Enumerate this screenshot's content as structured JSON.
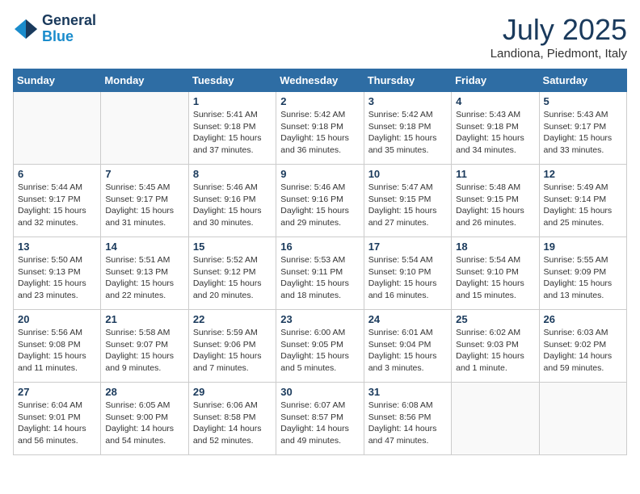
{
  "logo": {
    "line1": "General",
    "line2": "Blue"
  },
  "title": "July 2025",
  "location": "Landiona, Piedmont, Italy",
  "weekdays": [
    "Sunday",
    "Monday",
    "Tuesday",
    "Wednesday",
    "Thursday",
    "Friday",
    "Saturday"
  ],
  "weeks": [
    [
      {
        "day": null
      },
      {
        "day": null
      },
      {
        "day": "1",
        "sunrise": "Sunrise: 5:41 AM",
        "sunset": "Sunset: 9:18 PM",
        "daylight": "Daylight: 15 hours and 37 minutes."
      },
      {
        "day": "2",
        "sunrise": "Sunrise: 5:42 AM",
        "sunset": "Sunset: 9:18 PM",
        "daylight": "Daylight: 15 hours and 36 minutes."
      },
      {
        "day": "3",
        "sunrise": "Sunrise: 5:42 AM",
        "sunset": "Sunset: 9:18 PM",
        "daylight": "Daylight: 15 hours and 35 minutes."
      },
      {
        "day": "4",
        "sunrise": "Sunrise: 5:43 AM",
        "sunset": "Sunset: 9:18 PM",
        "daylight": "Daylight: 15 hours and 34 minutes."
      },
      {
        "day": "5",
        "sunrise": "Sunrise: 5:43 AM",
        "sunset": "Sunset: 9:17 PM",
        "daylight": "Daylight: 15 hours and 33 minutes."
      }
    ],
    [
      {
        "day": "6",
        "sunrise": "Sunrise: 5:44 AM",
        "sunset": "Sunset: 9:17 PM",
        "daylight": "Daylight: 15 hours and 32 minutes."
      },
      {
        "day": "7",
        "sunrise": "Sunrise: 5:45 AM",
        "sunset": "Sunset: 9:17 PM",
        "daylight": "Daylight: 15 hours and 31 minutes."
      },
      {
        "day": "8",
        "sunrise": "Sunrise: 5:46 AM",
        "sunset": "Sunset: 9:16 PM",
        "daylight": "Daylight: 15 hours and 30 minutes."
      },
      {
        "day": "9",
        "sunrise": "Sunrise: 5:46 AM",
        "sunset": "Sunset: 9:16 PM",
        "daylight": "Daylight: 15 hours and 29 minutes."
      },
      {
        "day": "10",
        "sunrise": "Sunrise: 5:47 AM",
        "sunset": "Sunset: 9:15 PM",
        "daylight": "Daylight: 15 hours and 27 minutes."
      },
      {
        "day": "11",
        "sunrise": "Sunrise: 5:48 AM",
        "sunset": "Sunset: 9:15 PM",
        "daylight": "Daylight: 15 hours and 26 minutes."
      },
      {
        "day": "12",
        "sunrise": "Sunrise: 5:49 AM",
        "sunset": "Sunset: 9:14 PM",
        "daylight": "Daylight: 15 hours and 25 minutes."
      }
    ],
    [
      {
        "day": "13",
        "sunrise": "Sunrise: 5:50 AM",
        "sunset": "Sunset: 9:13 PM",
        "daylight": "Daylight: 15 hours and 23 minutes."
      },
      {
        "day": "14",
        "sunrise": "Sunrise: 5:51 AM",
        "sunset": "Sunset: 9:13 PM",
        "daylight": "Daylight: 15 hours and 22 minutes."
      },
      {
        "day": "15",
        "sunrise": "Sunrise: 5:52 AM",
        "sunset": "Sunset: 9:12 PM",
        "daylight": "Daylight: 15 hours and 20 minutes."
      },
      {
        "day": "16",
        "sunrise": "Sunrise: 5:53 AM",
        "sunset": "Sunset: 9:11 PM",
        "daylight": "Daylight: 15 hours and 18 minutes."
      },
      {
        "day": "17",
        "sunrise": "Sunrise: 5:54 AM",
        "sunset": "Sunset: 9:10 PM",
        "daylight": "Daylight: 15 hours and 16 minutes."
      },
      {
        "day": "18",
        "sunrise": "Sunrise: 5:54 AM",
        "sunset": "Sunset: 9:10 PM",
        "daylight": "Daylight: 15 hours and 15 minutes."
      },
      {
        "day": "19",
        "sunrise": "Sunrise: 5:55 AM",
        "sunset": "Sunset: 9:09 PM",
        "daylight": "Daylight: 15 hours and 13 minutes."
      }
    ],
    [
      {
        "day": "20",
        "sunrise": "Sunrise: 5:56 AM",
        "sunset": "Sunset: 9:08 PM",
        "daylight": "Daylight: 15 hours and 11 minutes."
      },
      {
        "day": "21",
        "sunrise": "Sunrise: 5:58 AM",
        "sunset": "Sunset: 9:07 PM",
        "daylight": "Daylight: 15 hours and 9 minutes."
      },
      {
        "day": "22",
        "sunrise": "Sunrise: 5:59 AM",
        "sunset": "Sunset: 9:06 PM",
        "daylight": "Daylight: 15 hours and 7 minutes."
      },
      {
        "day": "23",
        "sunrise": "Sunrise: 6:00 AM",
        "sunset": "Sunset: 9:05 PM",
        "daylight": "Daylight: 15 hours and 5 minutes."
      },
      {
        "day": "24",
        "sunrise": "Sunrise: 6:01 AM",
        "sunset": "Sunset: 9:04 PM",
        "daylight": "Daylight: 15 hours and 3 minutes."
      },
      {
        "day": "25",
        "sunrise": "Sunrise: 6:02 AM",
        "sunset": "Sunset: 9:03 PM",
        "daylight": "Daylight: 15 hours and 1 minute."
      },
      {
        "day": "26",
        "sunrise": "Sunrise: 6:03 AM",
        "sunset": "Sunset: 9:02 PM",
        "daylight": "Daylight: 14 hours and 59 minutes."
      }
    ],
    [
      {
        "day": "27",
        "sunrise": "Sunrise: 6:04 AM",
        "sunset": "Sunset: 9:01 PM",
        "daylight": "Daylight: 14 hours and 56 minutes."
      },
      {
        "day": "28",
        "sunrise": "Sunrise: 6:05 AM",
        "sunset": "Sunset: 9:00 PM",
        "daylight": "Daylight: 14 hours and 54 minutes."
      },
      {
        "day": "29",
        "sunrise": "Sunrise: 6:06 AM",
        "sunset": "Sunset: 8:58 PM",
        "daylight": "Daylight: 14 hours and 52 minutes."
      },
      {
        "day": "30",
        "sunrise": "Sunrise: 6:07 AM",
        "sunset": "Sunset: 8:57 PM",
        "daylight": "Daylight: 14 hours and 49 minutes."
      },
      {
        "day": "31",
        "sunrise": "Sunrise: 6:08 AM",
        "sunset": "Sunset: 8:56 PM",
        "daylight": "Daylight: 14 hours and 47 minutes."
      },
      {
        "day": null
      },
      {
        "day": null
      }
    ]
  ]
}
